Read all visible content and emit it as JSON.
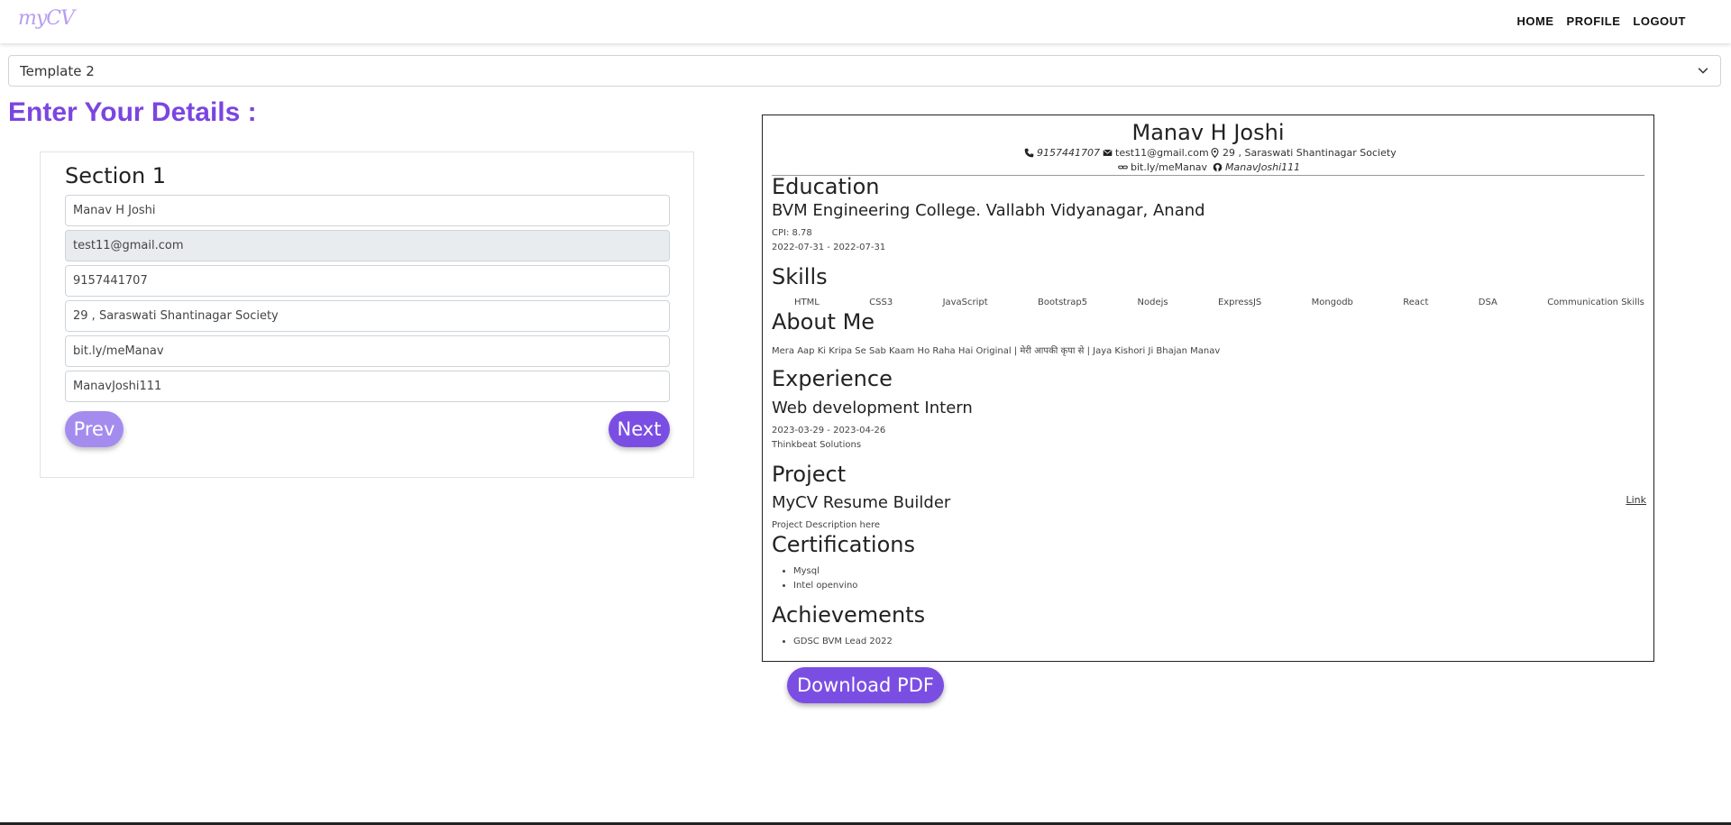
{
  "nav": {
    "logo": "myCV",
    "links": [
      "HOME",
      "PROFILE",
      "LOGOUT"
    ]
  },
  "template_select": {
    "value": "Template 2"
  },
  "heading": "Enter Your Details :",
  "form": {
    "section_title": "Section 1",
    "fields": [
      "Manav H Joshi",
      "test11@gmail.com",
      "9157441707",
      "29 , Saraswati Shantinagar Society",
      "bit.ly/meManav",
      "ManavJoshi111"
    ],
    "prev_label": "Prev",
    "next_label": "Next"
  },
  "resume": {
    "name": "Manav H Joshi",
    "phone": "9157441707",
    "email": "test11@gmail.com",
    "address": "29 , Saraswati Shantinagar Society",
    "website": "bit.ly/meManav",
    "github": "ManavJoshi111",
    "education": {
      "heading": "Education",
      "college": "BVM Engineering College. Vallabh Vidyanagar, Anand",
      "cpi": "CPI: 8.78",
      "dates": "2022-07-31 - 2022-07-31"
    },
    "skills": {
      "heading": "Skills",
      "items": [
        "HTML",
        "CSS3",
        "JavaScript",
        "Bootstrap5",
        "Nodejs",
        "ExpressJS",
        "Mongodb",
        "React",
        "DSA",
        "Communication Skills"
      ]
    },
    "about": {
      "heading": "About Me",
      "text": "Mera Aap Ki Kripa Se Sab Kaam Ho Raha Hai Original | मेरी आपकी कृपा से | Jaya Kishori Ji Bhajan Manav"
    },
    "experience": {
      "heading": "Experience",
      "title": "Web development Intern",
      "dates": "2023-03-29 - 2023-04-26",
      "company": "Thinkbeat Solutions"
    },
    "project": {
      "heading": "Project",
      "title": "MyCV Resume Builder",
      "link": "Link",
      "description": "Project Description here"
    },
    "certifications": {
      "heading": "Certifications",
      "items": [
        "Mysql",
        "Intel openvino"
      ]
    },
    "achievements": {
      "heading": "Achievements",
      "items": [
        "GDSC BVM Lead 2022"
      ]
    }
  },
  "download_label": "Download PDF"
}
